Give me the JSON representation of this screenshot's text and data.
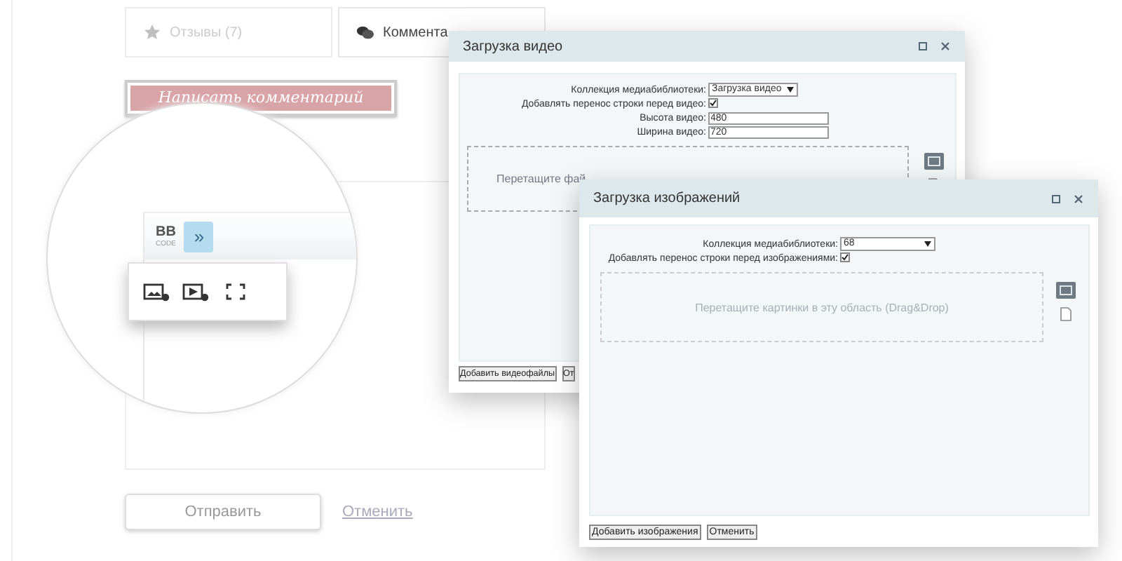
{
  "tabs": [
    {
      "label": "Отзывы (7)",
      "selected": false
    },
    {
      "label": "Коммента",
      "selected": true
    }
  ],
  "write_comment_button": "Написать комментарий",
  "editor": {
    "bb_code": {
      "label": "BB",
      "sublabel": "CODE"
    },
    "more_button": {
      "label": "»",
      "selected": true
    }
  },
  "form_buttons": {
    "submit": "Отправить",
    "cancel": "Отменить"
  },
  "video_dialog": {
    "title": "Загрузка видео",
    "fields": [
      {
        "kind": "select",
        "label": "Коллекция медиабиблиотеки:",
        "value": "Загрузка видео"
      },
      {
        "kind": "checkbox",
        "label": "Добавлять перенос строки перед видео:",
        "checked": true
      },
      {
        "kind": "text",
        "label": "Высота видео:",
        "value": "480"
      },
      {
        "kind": "text",
        "label": "Ширина видео:",
        "value": "720"
      }
    ],
    "dropzone": "Перетащите фай",
    "buttons": [
      "Добавить видеофайлы",
      "От"
    ]
  },
  "image_dialog": {
    "title": "Загрузка изображений",
    "fields": [
      {
        "kind": "select",
        "label": "Коллекция медиабиблиотеки:",
        "value": "68"
      },
      {
        "kind": "checkbox",
        "label": "Добавлять перенос строки перед изображениями:",
        "checked": true
      }
    ],
    "dropzone": "Перетащите картинки в эту область (Drag&Drop)",
    "buttons": [
      "Добавить изображения",
      "Отменить"
    ]
  }
}
